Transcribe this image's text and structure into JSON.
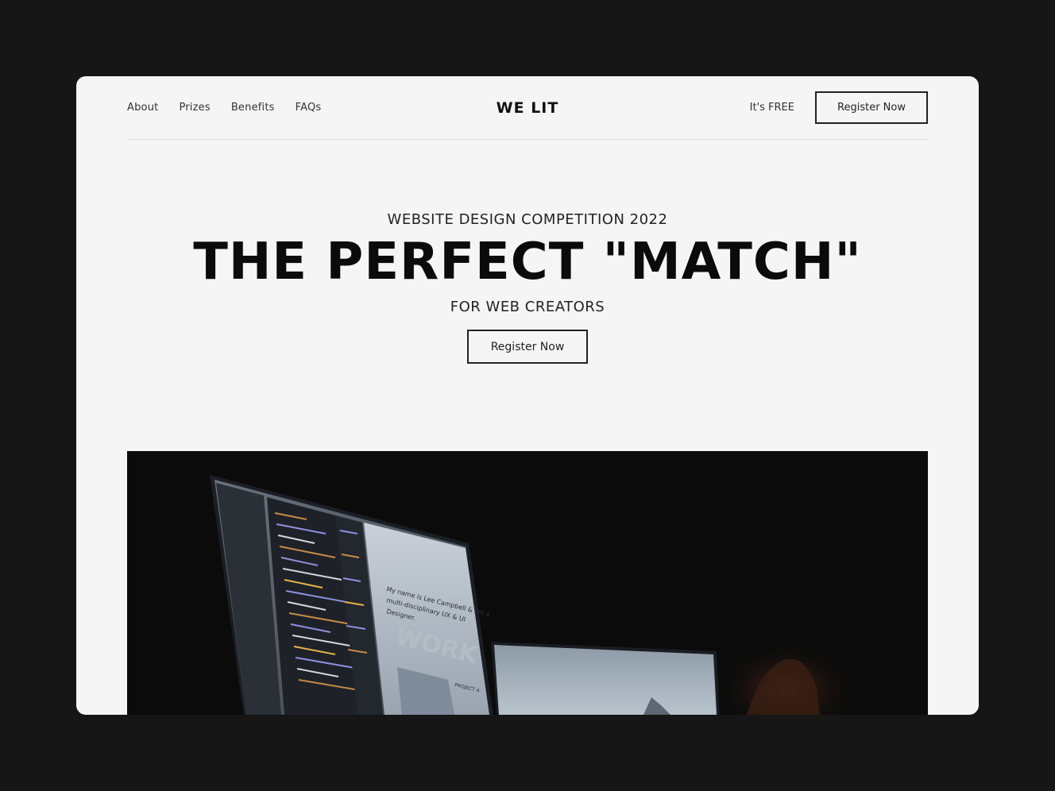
{
  "nav": {
    "links": [
      "About",
      "Prizes",
      "Benefits",
      "FAQs"
    ],
    "logo": "WE LIT",
    "free_label": "It's FREE",
    "cta_label": "Register Now"
  },
  "hero": {
    "eyebrow": "WEBSITE DESIGN COMPETITION 2022",
    "headline": "THE PERFECT \"MATCH\"",
    "subline": "FOR WEB CREATORS",
    "cta_label": "Register Now"
  },
  "media": {
    "image_subject": "laptops-with-code-and-portfolio-on-dark-background",
    "screen_text_line1": "My name is Lee Campbell & I'm a",
    "screen_text_line2": "multi-disciplinary UX & UI",
    "screen_text_line3": "Designer.",
    "screen_watermark": "WORK",
    "screen_project": "PROJECT A"
  },
  "colors": {
    "page_bg": "#161616",
    "card_bg": "#f5f5f5",
    "text": "#111111",
    "media_bg": "#0b0b0b"
  }
}
